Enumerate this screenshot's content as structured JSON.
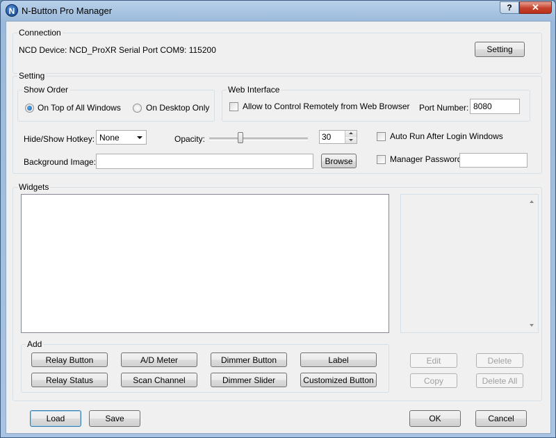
{
  "window": {
    "title": "N-Button Pro Manager",
    "help_label": "?",
    "close_label": "✕",
    "icon_letter": "N"
  },
  "connection": {
    "legend": "Connection",
    "status_text": "NCD Device: NCD_ProXR  Serial Port  COM9: 115200",
    "setting_button": "Setting"
  },
  "setting": {
    "legend": "Setting",
    "show_order": {
      "legend": "Show Order",
      "options": [
        "On Top of All Windows",
        "On Desktop Only"
      ],
      "selected": "On Top of All Windows"
    },
    "web_interface": {
      "legend": "Web Interface",
      "allow_label": "Allow to Control Remotely from Web Browser",
      "port_label": "Port Number:",
      "port_value": "8080"
    },
    "hotkey_label": "Hide/Show Hotkey:",
    "hotkey_value": "None",
    "opacity_label": "Opacity:",
    "opacity_value": "30",
    "auto_run_label": "Auto Run After Login Windows",
    "background_label": "Background Image:",
    "background_value": "",
    "browse_button": "Browse",
    "password_label": "Manager Password",
    "password_value": ""
  },
  "widgets": {
    "legend": "Widgets",
    "add": {
      "legend": "Add",
      "buttons": [
        "Relay Button",
        "A/D Meter",
        "Dimmer Button",
        "Label",
        "Relay Status",
        "Scan Channel",
        "Dimmer Slider",
        "Customized Button"
      ]
    },
    "edit_button": "Edit",
    "delete_button": "Delete",
    "copy_button": "Copy",
    "delete_all_button": "Delete All"
  },
  "footer": {
    "load": "Load",
    "save": "Save",
    "ok": "OK",
    "cancel": "Cancel"
  }
}
